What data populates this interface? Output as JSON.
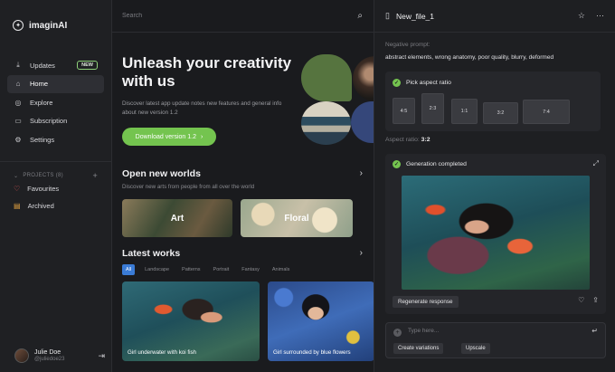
{
  "brand": {
    "name": "imaginAI"
  },
  "nav": [
    {
      "label": "Updates",
      "icon": "download-icon",
      "badge": "NEW"
    },
    {
      "label": "Home",
      "icon": "home-icon",
      "active": true
    },
    {
      "label": "Explore",
      "icon": "compass-icon"
    },
    {
      "label": "Subscription",
      "icon": "card-icon"
    },
    {
      "label": "Settings",
      "icon": "gear-icon"
    }
  ],
  "projects": {
    "header": "PROJECTS (8)",
    "items": [
      {
        "label": "Favourites",
        "icon": "heart-icon",
        "color": "#e05555"
      },
      {
        "label": "Archived",
        "icon": "archive-icon",
        "color": "#e0a040"
      }
    ]
  },
  "user": {
    "name": "Julie Doe",
    "handle": "@juliedoe23"
  },
  "search": {
    "placeholder": "Search"
  },
  "hero": {
    "title": "Unleash your creativity with us",
    "subtitle": "Discover latest app update notes new features and general info about new version 1.2",
    "button_label": "Download version 1.2"
  },
  "worlds": {
    "title": "Open new worlds",
    "subtitle": "Discover new arts from people from all over the world",
    "cards": [
      {
        "label": "Art"
      },
      {
        "label": "Floral"
      }
    ]
  },
  "latest": {
    "title": "Latest works",
    "filters": [
      "All",
      "Landscape",
      "Patterns",
      "Portrait",
      "Fantasy",
      "Animals"
    ],
    "works": [
      {
        "caption": "Girl underwater with koi fish"
      },
      {
        "caption": "Girl surrounded by blue flowers"
      }
    ]
  },
  "panel": {
    "file_name": "New_file_1",
    "negative_label": "Negative prompt:",
    "negative_value": "abstract elements, wrong anatomy, poor quality, blurry, deformed",
    "aspect_title": "Pick aspect ratio",
    "ratios": [
      "4:5",
      "2:3",
      "1:1",
      "3:2",
      "7:4"
    ],
    "aspect_label": "Aspect ratio:",
    "aspect_value": "3:2",
    "gen_title": "Generation completed",
    "regen_label": "Regenerate response",
    "prompt_placeholder": "Type here...",
    "suggestions": [
      "Create variations",
      "Upscale"
    ]
  },
  "colors": {
    "accent": "#74c44f",
    "filter_active": "#3a7bd5"
  }
}
